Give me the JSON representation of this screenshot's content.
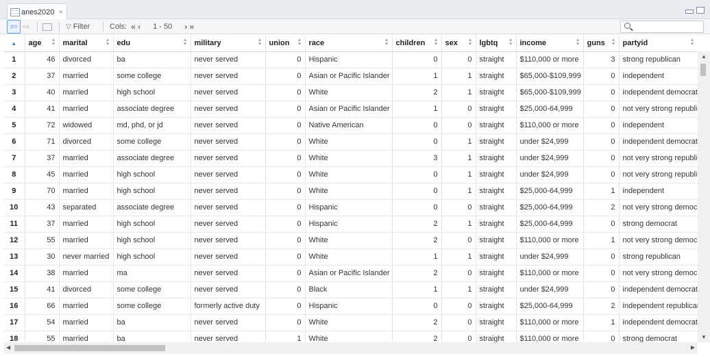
{
  "tab": {
    "label": "anes2020",
    "close": "×"
  },
  "toolbar": {
    "filter": "Filter",
    "cols": "Cols:",
    "cols_prev": "« ‹",
    "cols_range": "1 - 50",
    "cols_next": "› »",
    "search_placeholder": ""
  },
  "columns": [
    "age",
    "marital",
    "edu",
    "military",
    "union",
    "race",
    "children",
    "sex",
    "lgbtq",
    "income",
    "guns",
    "partyid"
  ],
  "rows": [
    [
      "1",
      "46",
      "divorced",
      "ba",
      "never served",
      "0",
      "Hispanic",
      "0",
      "0",
      "straight",
      "$110,000 or more",
      "3",
      "strong republican"
    ],
    [
      "2",
      "37",
      "married",
      "some college",
      "never served",
      "0",
      "Asian or Pacific Islander",
      "1",
      "1",
      "straight",
      "$65,000-$109,999",
      "0",
      "independent"
    ],
    [
      "3",
      "40",
      "married",
      "high school",
      "never served",
      "0",
      "White",
      "2",
      "1",
      "straight",
      "$65,000-$109,999",
      "0",
      "independent democrat"
    ],
    [
      "4",
      "41",
      "married",
      "associate degree",
      "never served",
      "0",
      "Asian or Pacific Islander",
      "1",
      "0",
      "straight",
      "$25,000-64,999",
      "0",
      "not very strong republican"
    ],
    [
      "5",
      "72",
      "widowed",
      "md, phd, or jd",
      "never served",
      "0",
      "Native American",
      "0",
      "0",
      "straight",
      "$110,000 or more",
      "0",
      "independent"
    ],
    [
      "6",
      "71",
      "divorced",
      "some college",
      "never served",
      "0",
      "White",
      "0",
      "1",
      "straight",
      "under $24,999",
      "0",
      "independent democrat"
    ],
    [
      "7",
      "37",
      "married",
      "associate degree",
      "never served",
      "0",
      "White",
      "3",
      "1",
      "straight",
      "under $24,999",
      "0",
      "not very strong republican"
    ],
    [
      "8",
      "45",
      "married",
      "high school",
      "never served",
      "0",
      "White",
      "0",
      "1",
      "straight",
      "under $24,999",
      "0",
      "not very strong republican"
    ],
    [
      "9",
      "70",
      "married",
      "high school",
      "never served",
      "0",
      "White",
      "0",
      "1",
      "straight",
      "$25,000-64,999",
      "1",
      "independent"
    ],
    [
      "10",
      "43",
      "separated",
      "associate degree",
      "never served",
      "0",
      "Hispanic",
      "0",
      "0",
      "straight",
      "$25,000-64,999",
      "2",
      "not very strong democrat"
    ],
    [
      "11",
      "37",
      "married",
      "high school",
      "never served",
      "0",
      "Hispanic",
      "2",
      "1",
      "straight",
      "$25,000-64,999",
      "0",
      "strong democrat"
    ],
    [
      "12",
      "55",
      "married",
      "high school",
      "never served",
      "0",
      "White",
      "2",
      "0",
      "straight",
      "$110,000 or more",
      "1",
      "not very strong democrat"
    ],
    [
      "13",
      "30",
      "never married",
      "high school",
      "never served",
      "0",
      "White",
      "1",
      "1",
      "straight",
      "under $24,999",
      "0",
      "strong republican"
    ],
    [
      "14",
      "38",
      "married",
      "ma",
      "never served",
      "0",
      "Asian or Pacific Islander",
      "2",
      "0",
      "straight",
      "$110,000 or more",
      "0",
      "not very strong democrat"
    ],
    [
      "15",
      "41",
      "divorced",
      "some college",
      "never served",
      "0",
      "Black",
      "1",
      "1",
      "straight",
      "under $24,999",
      "0",
      "independent democrat"
    ],
    [
      "16",
      "66",
      "married",
      "some college",
      "formerly active duty",
      "0",
      "Hispanic",
      "0",
      "0",
      "straight",
      "$25,000-64,999",
      "2",
      "independent republican"
    ],
    [
      "17",
      "54",
      "married",
      "ba",
      "never served",
      "0",
      "White",
      "2",
      "0",
      "straight",
      "$110,000 or more",
      "1",
      "independent democrat"
    ],
    [
      "18",
      "55",
      "married",
      "ba",
      "never served",
      "1",
      "White",
      "2",
      "0",
      "straight",
      "$110,000 or more",
      "0",
      "strong democrat"
    ]
  ]
}
